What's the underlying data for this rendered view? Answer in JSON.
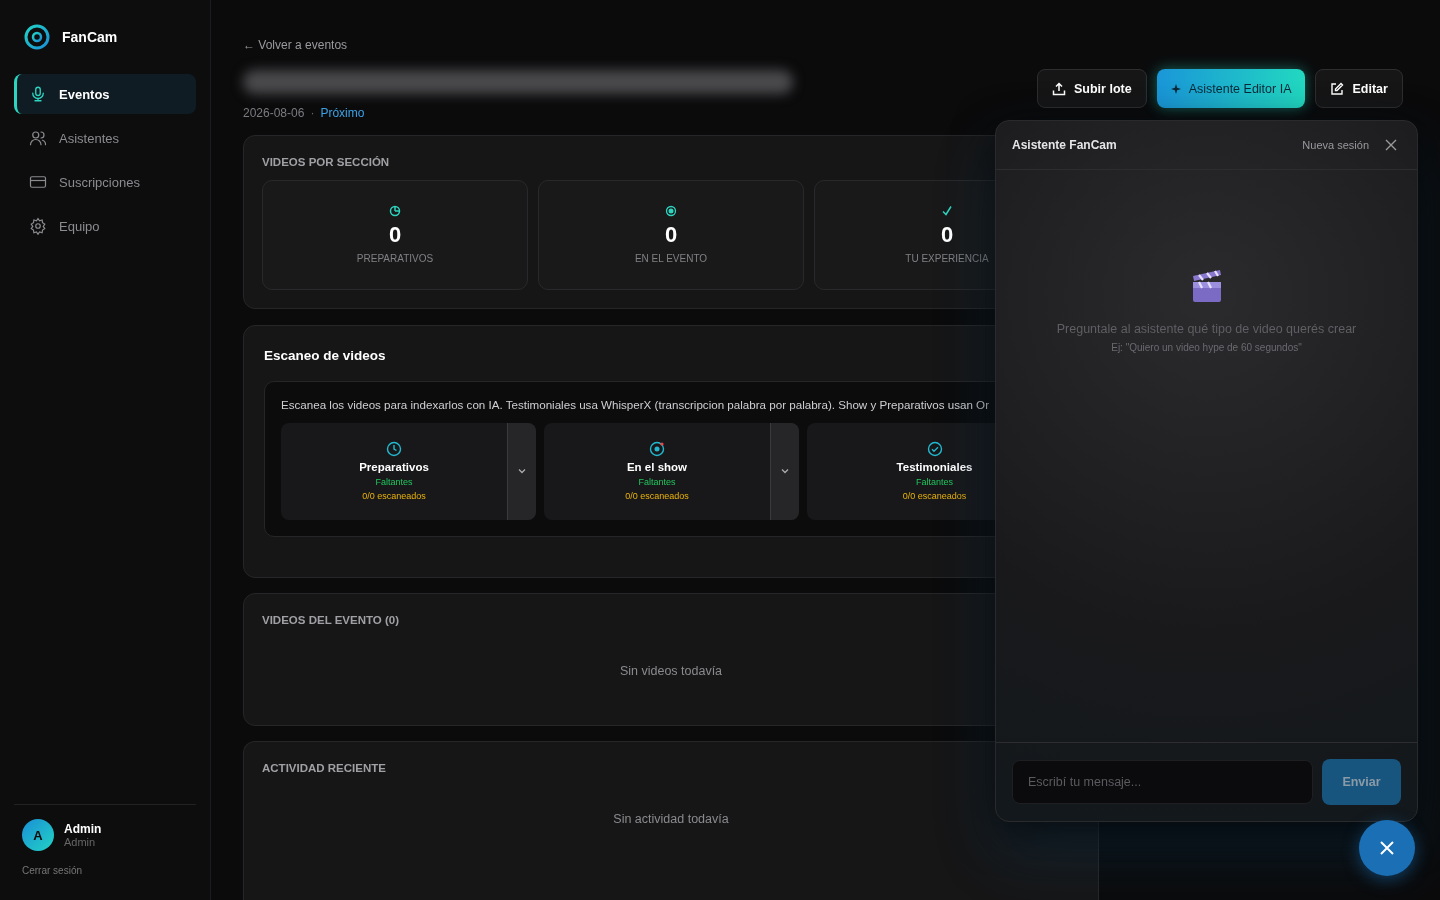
{
  "brand": {
    "name": "FanCam"
  },
  "nav": [
    {
      "label": "Eventos",
      "selected": true
    },
    {
      "label": "Asistentes",
      "selected": false
    },
    {
      "label": "Suscripciones",
      "selected": false
    },
    {
      "label": "Equipo",
      "selected": false
    }
  ],
  "user": {
    "initial": "A",
    "name": "Admin",
    "role": "Admin",
    "logout": "Cerrar sesión"
  },
  "back_link": "← Volver a eventos",
  "event": {
    "date": "2026-08-06",
    "separator": "·",
    "status": "Próximo"
  },
  "actions": [
    {
      "label": "Subir lote",
      "kind": "upload"
    },
    {
      "label": "Asistente Editor IA",
      "kind": "primary"
    },
    {
      "label": "Editar",
      "kind": "edit"
    }
  ],
  "sections_card": {
    "title": "VIDEOS POR SECCIÓN",
    "stats": [
      {
        "value": "0",
        "label": "PREPARATIVOS"
      },
      {
        "value": "0",
        "label": "EN EL EVENTO"
      },
      {
        "value": "0",
        "label": "TU EXPERIENCIA"
      }
    ]
  },
  "scan": {
    "title": "Escaneo de videos",
    "description": "Escanea los videos para indexarlos con IA. Testimoniales usa WhisperX (transcripcion palabra por palabra). Show y Preparativos usan Or",
    "groups": [
      {
        "name": "Preparativos",
        "status": "Faltantes",
        "progress": "0/0 escaneados",
        "expandable": true
      },
      {
        "name": "En el show",
        "status": "Faltantes",
        "progress": "0/0 escaneados",
        "expandable": true
      },
      {
        "name": "Testimoniales",
        "status": "Faltantes",
        "progress": "0/0 escaneados",
        "expandable": false
      }
    ]
  },
  "videos": {
    "title": "VIDEOS DEL EVENTO (0)",
    "empty": "Sin videos todavía"
  },
  "activity": {
    "title": "ACTIVIDAD RECIENTE",
    "empty": "Sin actividad todavía"
  },
  "chat": {
    "title": "Asistente FanCam",
    "new_session": "Nueva sesión",
    "prompt": "Preguntale al asistente qué tipo de video querés crear",
    "example": "Ej: \"Quiero un video hype de 60 segundos\"",
    "input": {
      "placeholder": "Escribí tu mensaje..."
    },
    "send": "Enviar"
  }
}
